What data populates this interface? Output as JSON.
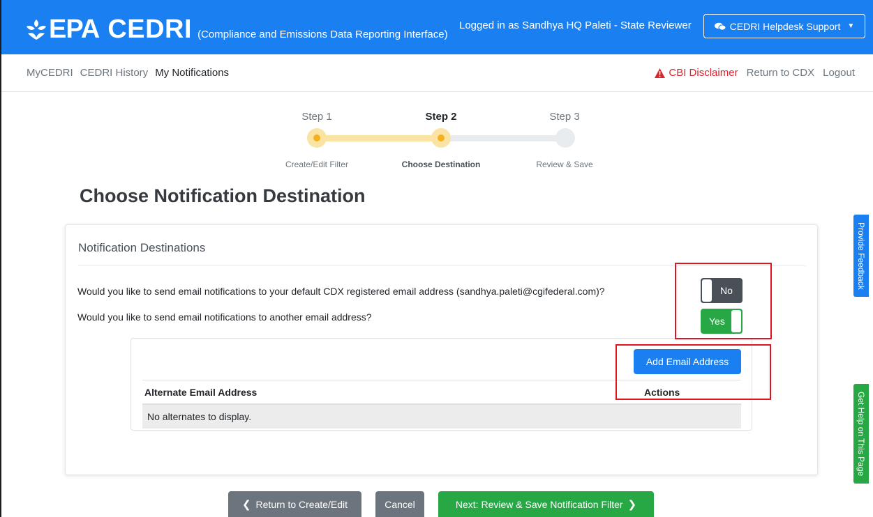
{
  "header": {
    "logo_epa": "EPA",
    "logo_cedri": "CEDRI",
    "logo_subtitle": "(Compliance and Emissions Data Reporting Interface)",
    "logged_in": "Logged in as Sandhya HQ Paleti - State Reviewer",
    "helpdesk_label": "CEDRI Helpdesk Support",
    "brand_color": "#1a7ff0"
  },
  "nav": {
    "left": [
      "MyCEDRI",
      "CEDRI History",
      "My Notifications"
    ],
    "active_index": 2,
    "cbi_label": "CBI Disclaimer",
    "return_label": "Return to CDX",
    "logout_label": "Logout"
  },
  "stepper": {
    "steps": [
      {
        "label": "Step 1",
        "sub": "Create/Edit Filter",
        "state": "done"
      },
      {
        "label": "Step 2",
        "sub": "Choose Destination",
        "state": "current"
      },
      {
        "label": "Step 3",
        "sub": "Review & Save",
        "state": "todo"
      }
    ],
    "progress_color": "#f3b21c"
  },
  "page_title": "Choose Notification Destination",
  "card": {
    "title": "Notification Destinations",
    "q1": "Would you like to send email notifications to your default CDX registered email address (sandhya.paleti@cgifederal.com)?",
    "q1_toggle": "No",
    "q2": "Would you like to send email notifications to another email address?",
    "q2_toggle": "Yes",
    "add_button": "Add Email Address",
    "table": {
      "columns": [
        "Alternate Email Address",
        "Actions"
      ],
      "empty_text": "No alternates to display."
    }
  },
  "side_tabs": {
    "feedback": "Provide Feedback",
    "help": "Get Help on This Page"
  },
  "footer": {
    "back": "Return to Create/Edit",
    "cancel": "Cancel",
    "next": "Next: Review & Save Notification Filter"
  }
}
